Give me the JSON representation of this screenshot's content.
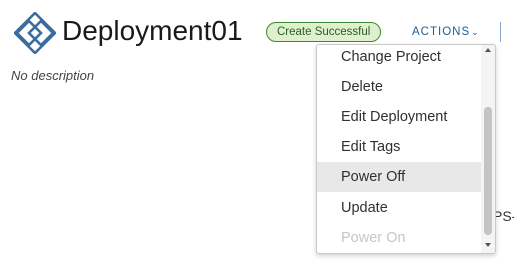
{
  "header": {
    "title": "Deployment01",
    "status_badge": "Create Successful",
    "actions_label": "ACTIONS",
    "logo_icon": "deployment-diamond-icon",
    "colors": {
      "logo": "#3a6d9e",
      "badge_bg": "#dff0d0",
      "badge_border": "#3c8a2e",
      "actions_text": "#1d5d99"
    }
  },
  "description": "No description",
  "background_peek_text": "PS-I",
  "actions_menu": {
    "items": [
      {
        "label": "Change Project",
        "state": "normal"
      },
      {
        "label": "Delete",
        "state": "normal"
      },
      {
        "label": "Edit Deployment",
        "state": "normal"
      },
      {
        "label": "Edit Tags",
        "state": "normal"
      },
      {
        "label": "Power Off",
        "state": "hovered"
      },
      {
        "label": "Update",
        "state": "normal"
      },
      {
        "label": "Power On",
        "state": "disabled"
      }
    ],
    "scroll_icons": [
      "scroll-up-arrow-icon",
      "scroll-down-arrow-icon"
    ]
  }
}
